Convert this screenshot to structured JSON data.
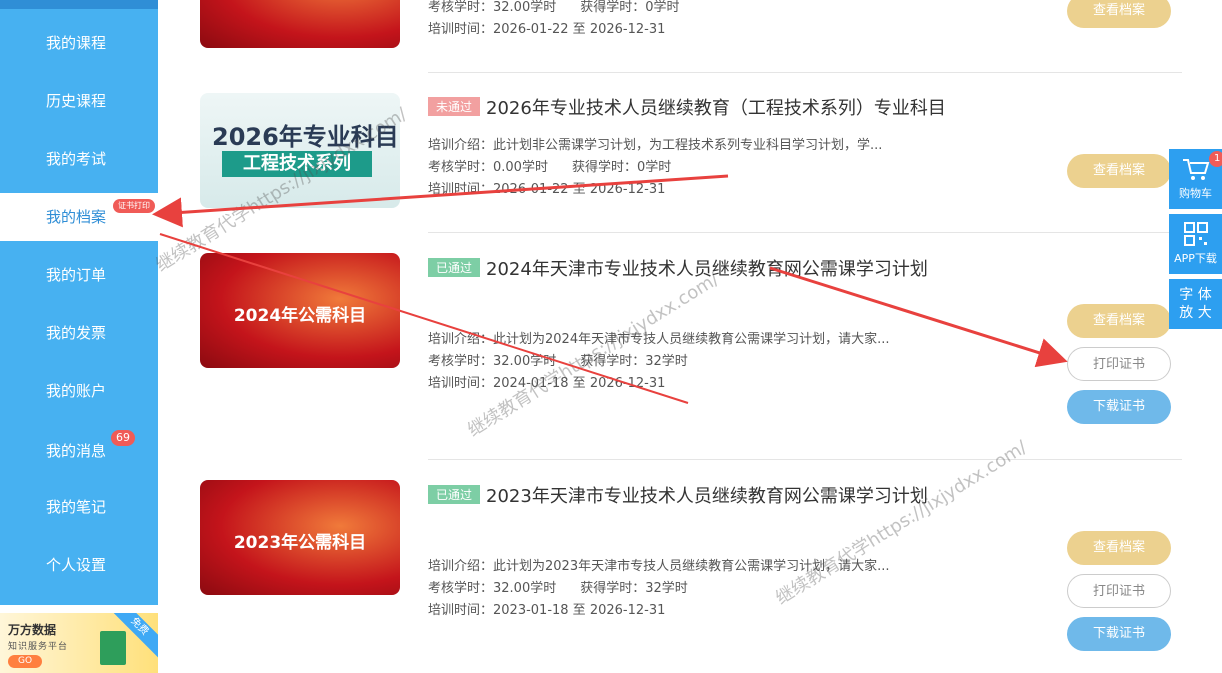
{
  "sidebar": {
    "items": [
      {
        "label": "我的课程"
      },
      {
        "label": "历史课程"
      },
      {
        "label": "我的考试"
      },
      {
        "label": "我的档案",
        "badge": "证书打印"
      },
      {
        "label": "我的订单"
      },
      {
        "label": "我的发票"
      },
      {
        "label": "我的账户"
      },
      {
        "label": "我的消息",
        "badge": "69"
      },
      {
        "label": "我的笔记"
      },
      {
        "label": "个人设置"
      }
    ],
    "promo": {
      "brand": "万方数据",
      "subtitle": "知识服务平台",
      "go": "GO",
      "ribbon": "免费"
    }
  },
  "courses": [
    {
      "hours_line": "考核学时：32.00学时",
      "earned": "获得学时：0学时",
      "date": "培训时间：2026-01-22 至 2026-12-31",
      "btn_dossier": "查看档案"
    },
    {
      "status": "未通过",
      "title": "2026年专业技术人员继续教育（工程技术系列）专业科目",
      "thumb_line1": "2026年专业科目",
      "thumb_line2": "工程技术系列",
      "intro": "培训介绍：此计划非公需课学习计划，为工程技术系列专业科目学习计划，学...",
      "hours_line": "考核学时：0.00学时",
      "earned": "获得学时：0学时",
      "date": "培训时间：2026-01-22 至 2026-12-31",
      "btn_dossier": "查看档案"
    },
    {
      "status": "已通过",
      "title": "2024年天津市专业技术人员继续教育网公需课学习计划",
      "thumb_text": "2024年公需科目",
      "intro": "培训介绍：此计划为2024年天津市专技人员继续教育公需课学习计划，请大家...",
      "hours_line": "考核学时：32.00学时",
      "earned": "获得学时：32学时",
      "date": "培训时间：2024-01-18 至 2026-12-31",
      "btn_dossier": "查看档案",
      "btn_print": "打印证书",
      "btn_download": "下载证书"
    },
    {
      "status": "已通过",
      "title": "2023年天津市专业技术人员继续教育网公需课学习计划",
      "thumb_text": "2023年公需科目",
      "intro": "培训介绍：此计划为2023年天津市专技人员继续教育公需课学习计划，请大家...",
      "hours_line": "考核学时：32.00学时",
      "earned": "获得学时：32学时",
      "date": "培训时间：2023-01-18 至 2026-12-31",
      "btn_dossier": "查看档案",
      "btn_print": "打印证书",
      "btn_download": "下载证书"
    }
  ],
  "right_tools": {
    "cart": "购物车",
    "cart_badge": "1",
    "app": "APP下载",
    "font": "字 体\n放 大"
  },
  "watermark": "继续教育代学https://jixjydxx.com/",
  "colors": {
    "sidebar": "#47b1f1",
    "accent": "#2d9ff0",
    "dossier_btn": "#ecd18f",
    "download_btn": "#6fb9ea",
    "arrow": "#e8413e"
  }
}
